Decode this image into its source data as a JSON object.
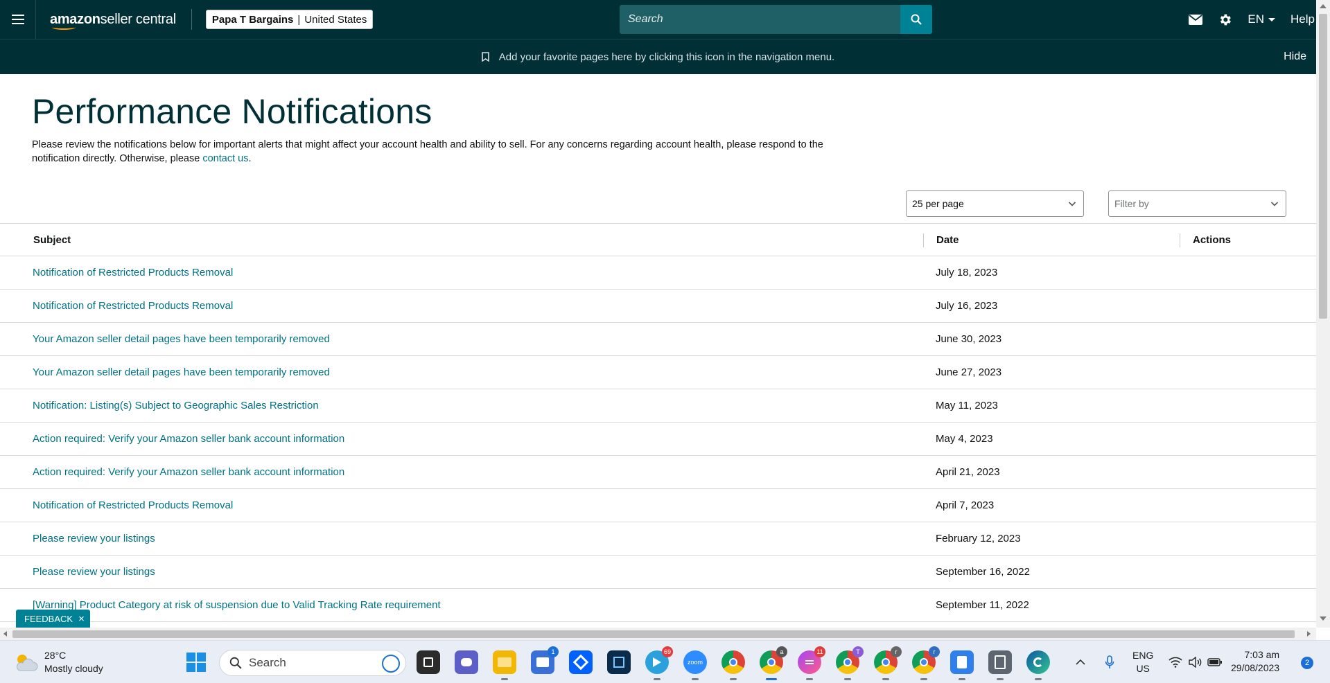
{
  "header": {
    "logo_main": "amazon",
    "logo_sub": " seller central",
    "store_name": "Papa T Bargains",
    "store_sep": "|",
    "store_region": "United States",
    "search_placeholder": "Search",
    "lang": "EN",
    "help": "Help"
  },
  "favbar": {
    "message": "Add your favorite pages here by clicking this icon in the navigation menu.",
    "hide": "Hide"
  },
  "page": {
    "title": "Performance Notifications",
    "intro_text": "Please review the notifications below for important alerts that might affect your account health and ability to sell. For any concerns regarding account health, please respond to the notification directly. Otherwise, please ",
    "intro_link": "contact us",
    "intro_end": "."
  },
  "controls": {
    "per_page": "25 per page",
    "filter_placeholder": "Filter by"
  },
  "table": {
    "columns": [
      "Subject",
      "Date",
      "Actions"
    ],
    "rows": [
      {
        "subject": "Notification of Restricted Products Removal",
        "date": "July 18, 2023"
      },
      {
        "subject": "Notification of Restricted Products Removal",
        "date": "July 16, 2023"
      },
      {
        "subject": "Your Amazon seller detail pages have been temporarily removed",
        "date": "June 30, 2023"
      },
      {
        "subject": "Your Amazon seller detail pages have been temporarily removed",
        "date": "June 27, 2023"
      },
      {
        "subject": "Notification: Listing(s) Subject to Geographic Sales Restriction",
        "date": "May 11, 2023"
      },
      {
        "subject": "Action required: Verify your Amazon seller bank account information",
        "date": "May 4, 2023"
      },
      {
        "subject": "Action required: Verify your Amazon seller bank account information",
        "date": "April 21, 2023"
      },
      {
        "subject": "Notification of Restricted Products Removal",
        "date": "April 7, 2023"
      },
      {
        "subject": "Please review your listings",
        "date": "February 12, 2023"
      },
      {
        "subject": "Please review your listings",
        "date": "September 16, 2022"
      },
      {
        "subject": "[Warning] Product Category at risk of suspension due to Valid Tracking Rate requirement",
        "date": "September 11, 2022"
      }
    ]
  },
  "feedback": {
    "label": "FEEDBACK",
    "close": "×"
  },
  "taskbar": {
    "weather_temp": "28°C",
    "weather_desc": "Mostly cloudy",
    "search_placeholder": "Search",
    "badges": {
      "store": "1",
      "telegram": "69",
      "messenger": "11"
    },
    "avatar_letters": {
      "chrome_a": "a",
      "chrome_t": "T",
      "chrome_r1": "r",
      "chrome_r2": "r"
    },
    "zoom_label": "zoom",
    "lang_top": "ENG",
    "lang_bottom": "US",
    "time": "7:03 am",
    "date": "29/08/2023",
    "notification_count": "2"
  }
}
